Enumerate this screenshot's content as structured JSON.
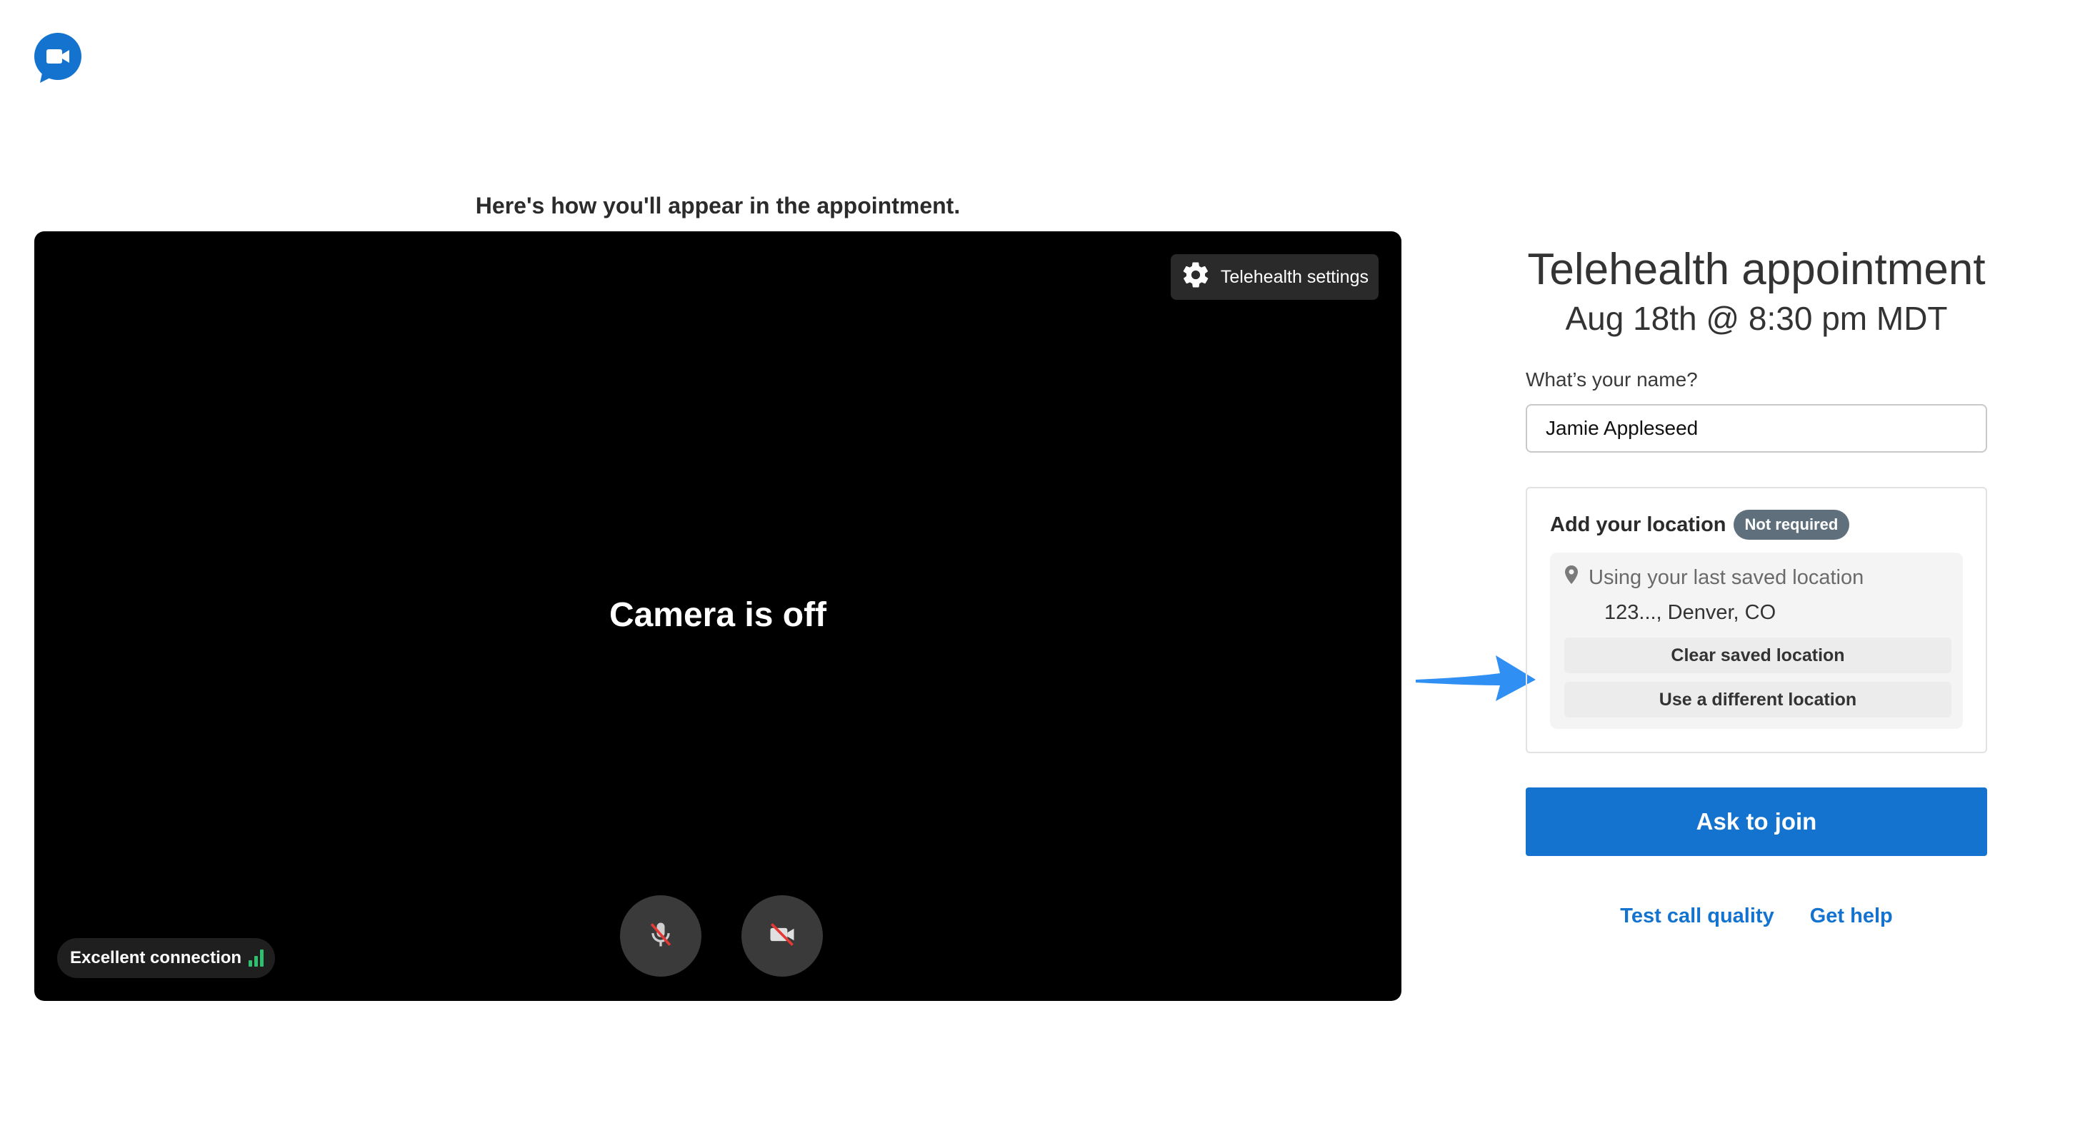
{
  "app": {
    "logo_icon": "video-chat-bubble-icon",
    "accent_color": "#1473ce"
  },
  "preview": {
    "caption": "Here's how you'll appear in the appointment.",
    "settings_label": "Telehealth settings",
    "settings_icon": "gear-icon",
    "camera_status": "Camera is off",
    "connection_label": "Excellent connection",
    "connection_icon": "signal-bars-icon",
    "connection_color": "#2fbf71",
    "mic_icon": "microphone-off-icon",
    "camera_icon": "camera-off-icon"
  },
  "appointment": {
    "title": "Telehealth appointment",
    "datetime": "Aug 18th @ 8:30 pm MDT"
  },
  "form": {
    "name_label": "What’s your name?",
    "name_value": "Jamie Appleseed"
  },
  "location": {
    "heading": "Add your location",
    "badge": "Not required",
    "saved_label": "Using your last saved location",
    "saved_address": "123..., Denver, CO",
    "pin_icon": "map-pin-icon",
    "clear_label": "Clear saved location",
    "different_label": "Use a different location"
  },
  "actions": {
    "join_label": "Ask to join",
    "test_label": "Test call quality",
    "help_label": "Get help"
  },
  "annotation": {
    "arrow_icon": "blue-arrow-icon",
    "arrow_color": "#2f8ff2"
  }
}
